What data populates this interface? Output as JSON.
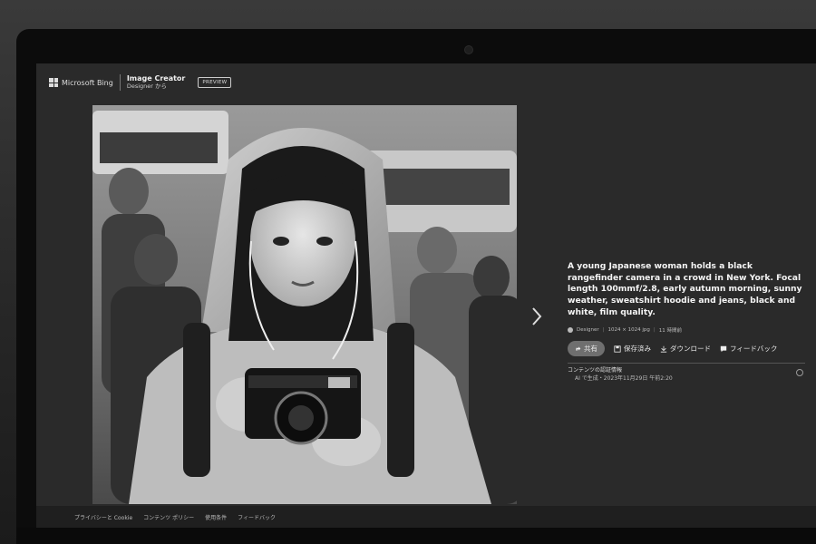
{
  "header": {
    "brand": "Microsoft Bing",
    "app_title": "Image Creator",
    "app_subtitle": "Designer から",
    "badge": "PREVIEW"
  },
  "image": {
    "description_icon": "generated-photo"
  },
  "details": {
    "prompt": "A young Japanese woman holds a black rangefinder camera in a crowd in New York. Focal length 100mmf/2.8, early autumn morning, sunny weather, sweatshirt hoodie and jeans, black and white, film quality.",
    "meta_source": "Designer",
    "meta_size": "1024 × 1024 jpg",
    "meta_age": "11 時間前",
    "share_label": "共有",
    "save_label": "保存済み",
    "download_label": "ダウンロード",
    "feedback_label": "フィードバック",
    "credential_title": "コンテンツの認証情報",
    "credential_detail": "AI で生成・2023年11月29日 午前2:20"
  },
  "footer": {
    "links": [
      "プライバシーと Cookie",
      "コンテンツ ポリシー",
      "使用条件",
      "フィードバック"
    ]
  },
  "colors": {
    "screen_bg": "#2a2a2a",
    "bezel": "#0c0c0c",
    "accent": "#6f6f6f"
  }
}
